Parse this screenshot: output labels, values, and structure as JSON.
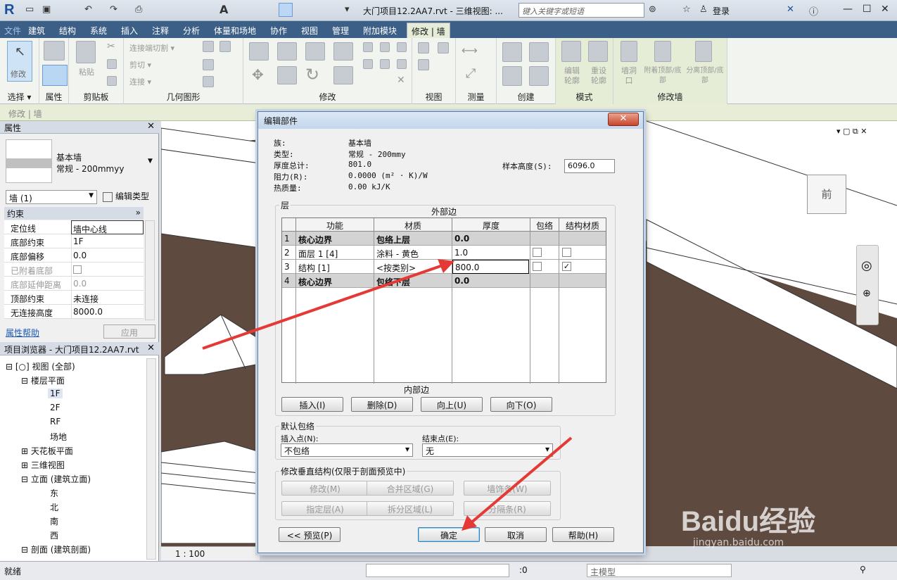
{
  "app": {
    "doc_title": "大门项目12.2AA7.rvt - 三维视图: ...",
    "search_placeholder": "键入关键字或短语",
    "login": "登录"
  },
  "menu": {
    "tabs": [
      "文件",
      "建筑",
      "结构",
      "系统",
      "插入",
      "注释",
      "分析",
      "体量和场地",
      "协作",
      "视图",
      "管理",
      "附加模块"
    ],
    "active_tab": "修改 | 墙"
  },
  "ribbon": {
    "groups": [
      "选择",
      "属性",
      "剪贴板",
      "几何图形",
      "修改",
      "视图",
      "测量",
      "创建",
      "模式",
      "修改墙"
    ],
    "modify_label": "修改",
    "paste_label": "粘贴",
    "geom_items": [
      "连接端切割",
      "剪切",
      "连接"
    ],
    "mode_items": [
      "编辑轮廓",
      "重设轮廓"
    ],
    "wall_items": [
      "墙洞口",
      "附着顶部/底部",
      "分离顶部/底部"
    ]
  },
  "context_bar": "修改 | 墙",
  "properties": {
    "title": "属性",
    "type_family": "基本墙",
    "type_name": "常规 - 200mmyy",
    "instance_dropdown": "墙 (1)",
    "edit_type": "编辑类型",
    "section": "约束",
    "rows": [
      {
        "k": "定位线",
        "v": "墙中心线"
      },
      {
        "k": "底部约束",
        "v": "1F"
      },
      {
        "k": "底部偏移",
        "v": "0.0"
      },
      {
        "k": "已附着底部",
        "v": ""
      },
      {
        "k": "底部延伸距离",
        "v": "0.0"
      },
      {
        "k": "顶部约束",
        "v": "未连接"
      },
      {
        "k": "无连接高度",
        "v": "8000.0"
      }
    ],
    "help": "属性帮助",
    "apply": "应用"
  },
  "browser": {
    "title": "项目浏览器 - 大门项目12.2AA7.rvt",
    "items": [
      "视图 (全部)",
      "楼层平面",
      "1F",
      "2F",
      "RF",
      "场地",
      "天花板平面",
      "三维视图",
      "立面 (建筑立面)",
      "东",
      "北",
      "南",
      "西",
      "剖面 (建筑剖面)"
    ]
  },
  "view_scale": "1 : 100",
  "statusbar": {
    "left": "就绪",
    "count": ":0",
    "model": "主模型"
  },
  "dialog": {
    "title": "编辑部件",
    "info": [
      {
        "k": "族:",
        "v": "基本墙"
      },
      {
        "k": "类型:",
        "v": "常规 - 200mmy"
      },
      {
        "k": "厚度总计:",
        "v": "801.0"
      },
      {
        "k": "阻力(R):",
        "v": "0.0000 (m² · K)/W"
      },
      {
        "k": "热质量:",
        "v": "0.00 kJ/K"
      }
    ],
    "sample_height_label": "样本高度(S):",
    "sample_height": "6096.0",
    "layers_legend": "层",
    "exterior": "外部边",
    "interior": "内部边",
    "columns": [
      "功能",
      "材质",
      "厚度",
      "包络",
      "结构材质"
    ],
    "rows": [
      {
        "n": "1",
        "func": "核心边界",
        "mat": "包络上层",
        "thk": "0.0",
        "wrap": null,
        "struct": null,
        "bold": true
      },
      {
        "n": "2",
        "func": "面层 1 [4]",
        "mat": "涂料 - 黄色",
        "thk": "1.0",
        "wrap": false,
        "struct": false,
        "bold": false
      },
      {
        "n": "3",
        "func": "结构 [1]",
        "mat": "<按类别>",
        "thk": "800.0",
        "wrap": false,
        "struct": true,
        "bold": false
      },
      {
        "n": "4",
        "func": "核心边界",
        "mat": "包络下层",
        "thk": "0.0",
        "wrap": null,
        "struct": null,
        "bold": true
      }
    ],
    "btn_insert": "插入(I)",
    "btn_delete": "删除(D)",
    "btn_up": "向上(U)",
    "btn_down": "向下(O)",
    "wrap_legend": "默认包络",
    "insert_pt_label": "插入点(N):",
    "insert_pt": "不包络",
    "end_pt_label": "结束点(E):",
    "end_pt": "无",
    "vert_legend": "修改垂直结构(仅限于剖面预览中)",
    "btn_modify": "修改(M)",
    "btn_merge": "合并区域(G)",
    "btn_sweep": "墙饰条(W)",
    "btn_assign": "指定层(A)",
    "btn_split": "拆分区域(L)",
    "btn_reveal": "分隔条(R)",
    "btn_preview": "<< 预览(P)",
    "btn_ok": "确定",
    "btn_cancel": "取消",
    "btn_help": "帮助(H)"
  },
  "watermark": "Baidu经验",
  "watermark_url": "jingyan.baidu.com",
  "viewcube_face": "前",
  "colors": {
    "menu_bg": "#3c5f88",
    "context_green": "#e6edd7",
    "floor_brown": "#5e4a3f",
    "arrow_red": "#e53935"
  }
}
